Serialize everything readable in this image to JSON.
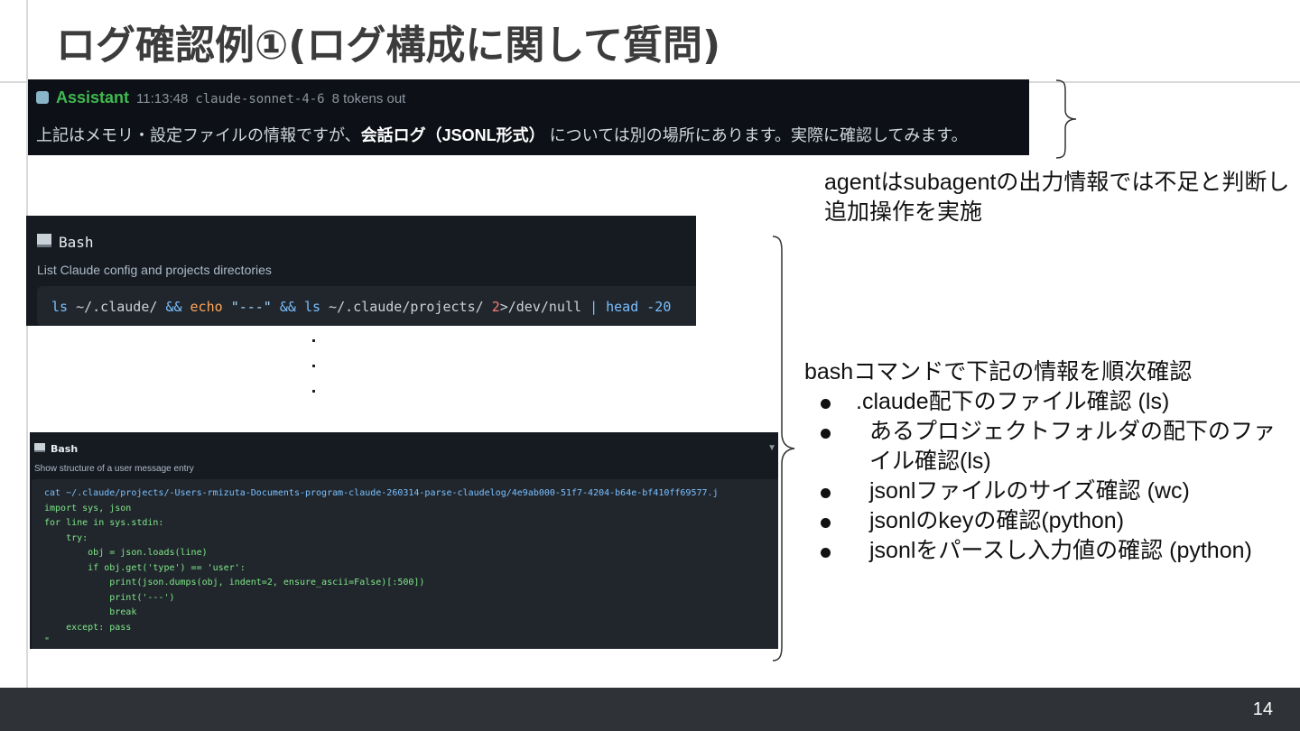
{
  "slide": {
    "title": "ログ確認例①(ログ構成に関して質問)",
    "page_number": "14"
  },
  "assistant_panel": {
    "icon": "robot-icon",
    "name": "Assistant",
    "time": "11:13:48",
    "model": "claude-sonnet-4-6",
    "tokens": "8 tokens out",
    "message_pre": "上記はメモリ・設定ファイルの情報ですが、",
    "message_bold": "会話ログ（JSONL形式）",
    "message_post": " については別の場所にあります。実際に確認してみます。"
  },
  "note_agent": "agentはsubagentの出力情報では不足と判断し追加操作を実施",
  "bash_panel_1": {
    "icon": "terminal-icon",
    "title": "Bash",
    "description": "List Claude config and projects directories",
    "code": {
      "t1": "ls",
      "t2": " ~/.claude/ ",
      "t3": "&&",
      "t4": " echo ",
      "t5": "\"---\"",
      "t6": " && ",
      "t7": "ls",
      "t8": " ~/.claude/projects/ ",
      "t9": "2",
      "t10": ">/dev/null ",
      "t11": "| head -20"
    }
  },
  "bash_panel_2": {
    "icon": "terminal-icon",
    "title": "Bash",
    "collapse_icon": "triangle-down-icon",
    "collapse_glyph": "▼",
    "description": "Show structure of a user message entry",
    "code_lines": [
      "cat ~/.claude/projects/-Users-rmizuta-Documents-program-claude-260314-parse-claudelog/4e9ab000-51f7-4204-b64e-bf410ff69577.j",
      "import sys, json",
      "for line in sys.stdin:",
      "    try:",
      "        obj = json.loads(line)",
      "        if obj.get('type') == 'user':",
      "            print(json.dumps(obj, indent=2, ensure_ascii=False)[:500])",
      "            print('---')",
      "            break",
      "    except: pass",
      "\""
    ]
  },
  "note_bash": {
    "heading": "bashコマンドで下記の情報を順次確認",
    "items": [
      ".claude配下のファイル確認 (ls)",
      "あるプロジェクトフォルダの配下のファイル確認(ls)",
      "jsonlファイルのサイズ確認 (wc)",
      "jsonlのkeyの確認(python)",
      "jsonlをパースし入力値の確認 (python)"
    ]
  }
}
